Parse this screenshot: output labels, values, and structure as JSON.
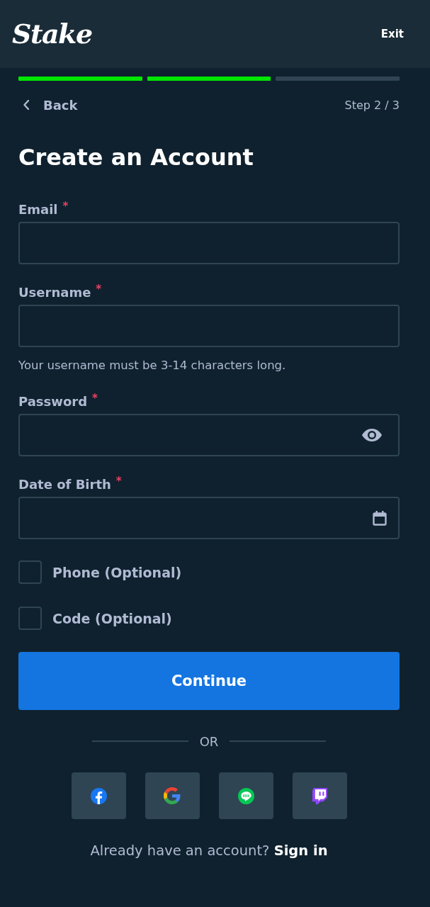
{
  "header": {
    "logo": "Stake",
    "exit": "Exit"
  },
  "progress": {
    "steps": [
      {
        "complete": true
      },
      {
        "complete": true
      },
      {
        "complete": false
      }
    ]
  },
  "nav": {
    "back": "Back",
    "step": "Step 2 / 3"
  },
  "title": "Create an Account",
  "fields": [
    {
      "kind": "text",
      "label": "Email",
      "required_mark": "*"
    },
    {
      "kind": "text",
      "label": "Username",
      "required_mark": "*",
      "hint": "Your username must be 3-14 characters long."
    },
    {
      "kind": "password",
      "label": "Password",
      "required_mark": "*"
    },
    {
      "kind": "date",
      "label": "Date of Birth",
      "required_mark": "*"
    }
  ],
  "options": [
    {
      "label": "Phone (Optional)",
      "checked": false
    },
    {
      "label": "Code (Optional)",
      "checked": false
    }
  ],
  "continue": "Continue",
  "divider": "OR",
  "social_buttons": [
    {
      "kind": "facebook"
    },
    {
      "kind": "google"
    },
    {
      "kind": "line"
    },
    {
      "kind": "twitch"
    }
  ],
  "footer": {
    "prompt": "Already have an account?",
    "link": "Sign in"
  }
}
